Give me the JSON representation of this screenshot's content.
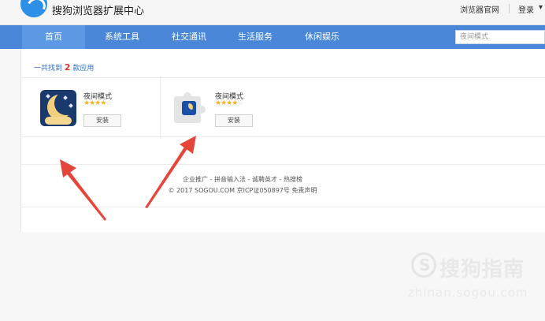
{
  "header": {
    "title": "搜狗浏览器扩展中心",
    "links": [
      "浏览器官网",
      "登录"
    ]
  },
  "nav": {
    "items": [
      "首页",
      "系统工具",
      "社交通讯",
      "生活服务",
      "休闲娱乐"
    ],
    "active": "首页",
    "search_placeholder": "夜间模式"
  },
  "results": {
    "prefix": "一共找到",
    "count": "2",
    "suffix": "款应用"
  },
  "apps": [
    {
      "name": "夜间模式",
      "icon": "moon-night-icon",
      "rating": 4,
      "max_rating": 5,
      "action": "安装"
    },
    {
      "name": "夜间模式",
      "icon": "puzzle-extension-icon",
      "rating": 4,
      "max_rating": 5,
      "action": "安装"
    }
  ],
  "footer": {
    "links": "企业推广 - 拼音输入法 - 诚聘英才 - 热搜榜",
    "copyright": "© 2017 SOGOU.COM 京ICP证050897号 免责声明"
  },
  "watermark": {
    "text": "搜狗指南",
    "url": "zhinan.sogou.com"
  },
  "colors": {
    "nav": "#4a87d8",
    "count": "#e0322d",
    "arrow": "#e5453b",
    "star": "#f5b320"
  }
}
